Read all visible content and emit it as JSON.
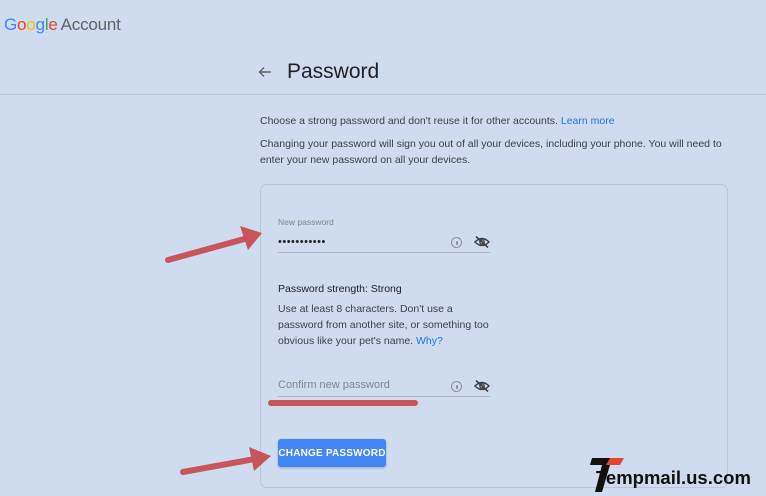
{
  "header": {
    "brand_g1": "G",
    "brand_g2": "o",
    "brand_g3": "o",
    "brand_g4": "g",
    "brand_g5": "l",
    "brand_g6": "e",
    "brand_account": "Account"
  },
  "page": {
    "title": "Password",
    "intro_text": "Choose a strong password and don't reuse it for other accounts.",
    "learn_more": "Learn more",
    "intro_2": "Changing your password will sign you out of all your devices, including your phone. You will need to enter your new password on all your devices."
  },
  "form": {
    "new_password_label": "New password",
    "new_password_value": "•••••••••••",
    "strength": "Password strength: Strong",
    "hint": "Use at least 8 characters. Don't use a password from another site, or something too obvious like your pet's name.",
    "why_link": "Why?",
    "confirm_placeholder": "Confirm new password",
    "submit_label": "CHANGE PASSWORD"
  },
  "watermark": {
    "text": "Tempmail.us.com"
  },
  "colors": {
    "background": "#cfdcef",
    "primary_button": "#4285f4",
    "link": "#1a73e8",
    "annotation_arrow": "#c8555a"
  },
  "icons": [
    "back-arrow-icon",
    "key-icon",
    "eye-off-icon"
  ]
}
